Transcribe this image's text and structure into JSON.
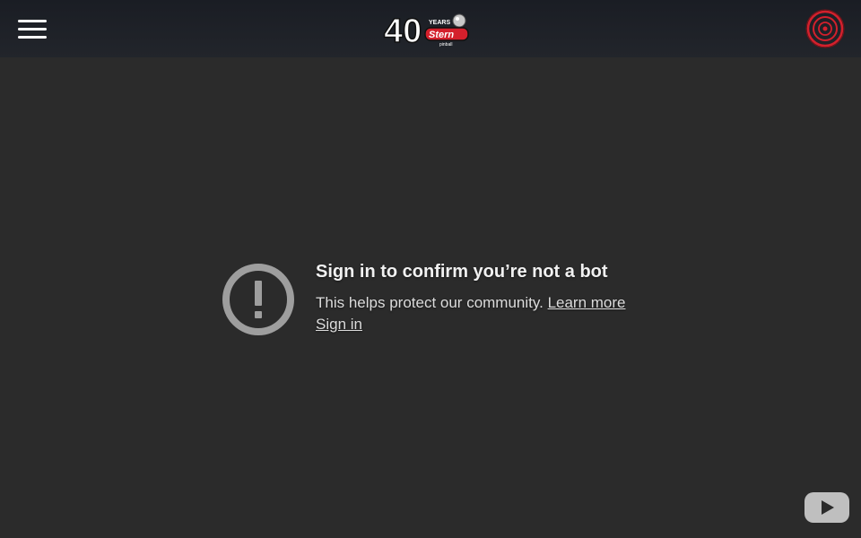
{
  "header": {
    "logo_number": "40",
    "logo_years": "YEARS",
    "logo_brand": "Stern",
    "logo_sub": "pinball"
  },
  "player": {
    "title": "Sign in to confirm you’re not a bot",
    "body_text": "This helps protect our community. ",
    "learn_more": "Learn more",
    "sign_in": "Sign in"
  },
  "colors": {
    "background": "#2b2b2b",
    "header": "#1a1d24",
    "accent": "#d4202c"
  }
}
